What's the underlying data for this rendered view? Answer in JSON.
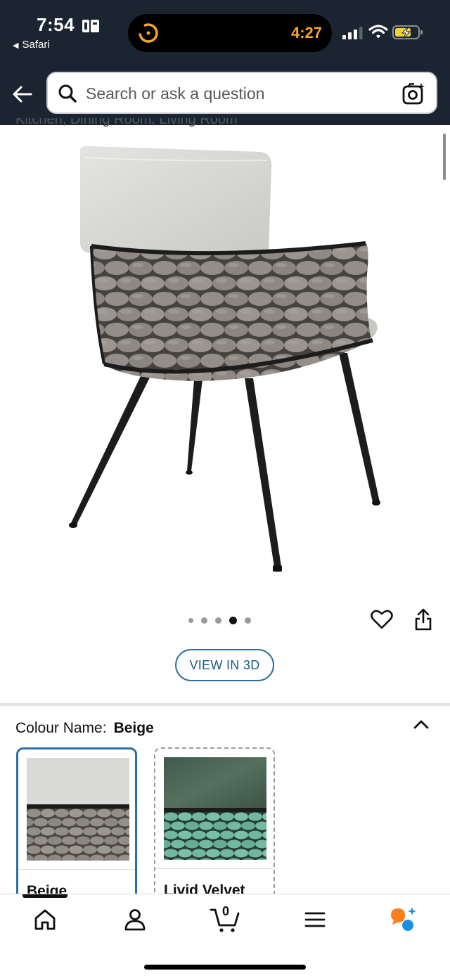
{
  "status_bar": {
    "time": "7:54",
    "back_app": "Safari",
    "timer": "4:27"
  },
  "search": {
    "placeholder": "Search or ask a question"
  },
  "product": {
    "title_fragment": "Kitchen, Dining Room, Living Room",
    "gallery_dots": {
      "count": 5,
      "active_index": 3
    },
    "view_3d_label": "VIEW IN 3D"
  },
  "variation": {
    "label": "Colour Name:",
    "selected_value": "Beige",
    "options": [
      {
        "name": "Beige",
        "selected": true
      },
      {
        "name": "Livid Velvet",
        "selected": false
      }
    ]
  },
  "bottom_nav": {
    "items": [
      "home-icon",
      "account-icon",
      "cart-icon",
      "menu-icon",
      "rufus-icon"
    ],
    "cart_count": "0"
  },
  "colors": {
    "header_bg": "#1b2431",
    "accent_blue": "#2f6fa8",
    "timer_orange": "#f7a428",
    "battery_yellow": "#f5d22c"
  }
}
